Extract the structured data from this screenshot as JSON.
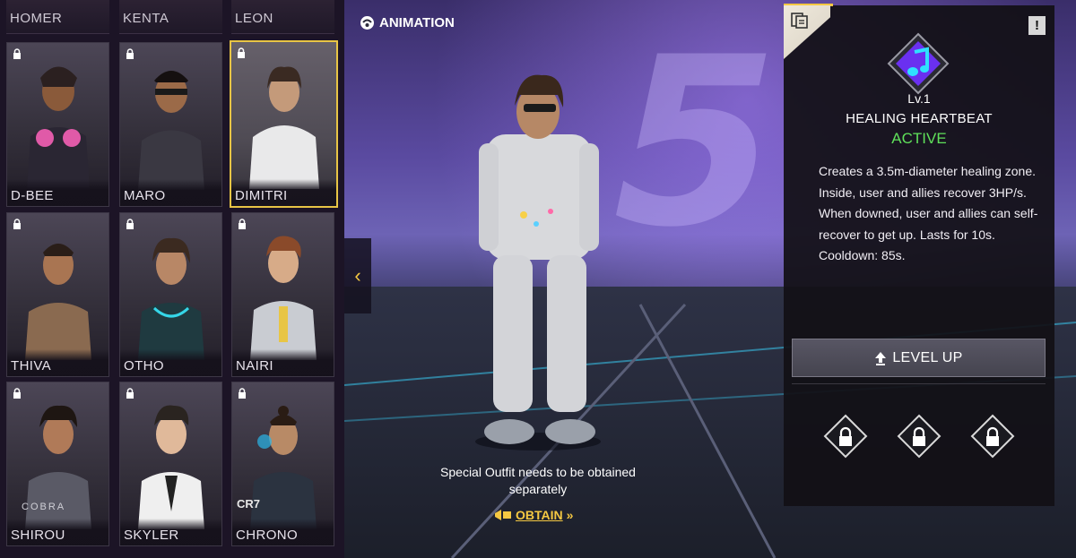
{
  "top_row": [
    "HOMER",
    "KENTA",
    "LEON"
  ],
  "characters": [
    {
      "name": "D-BEE",
      "locked": true,
      "selected": false
    },
    {
      "name": "MARO",
      "locked": true,
      "selected": false
    },
    {
      "name": "DIMITRI",
      "locked": true,
      "selected": true
    },
    {
      "name": "THIVA",
      "locked": true,
      "selected": false
    },
    {
      "name": "OTHO",
      "locked": true,
      "selected": false
    },
    {
      "name": "NAIRI",
      "locked": true,
      "selected": false
    },
    {
      "name": "SHIROU",
      "locked": true,
      "selected": false
    },
    {
      "name": "SKYLER",
      "locked": true,
      "selected": false
    },
    {
      "name": "CHRONO",
      "locked": true,
      "selected": false
    }
  ],
  "card_marks": {
    "shirou_brand": "COBRA",
    "chrono_brand": "CR7"
  },
  "stage": {
    "animation_label": "ANIMATION",
    "outfit_note": "Special Outfit needs to be obtained separately",
    "obtain_label": "OBTAIN",
    "obtain_arrows": "»",
    "back_arrow": "‹"
  },
  "skill": {
    "level": "Lv.1",
    "name": "HEALING HEARTBEAT",
    "status": "ACTIVE",
    "description": "Creates a 3.5m-diameter healing zone. Inside, user and allies recover 3HP/s. When downed, user and allies can self-recover to get up. Lasts for 10s. Cooldown: 85s.",
    "level_up_label": "LEVEL UP",
    "locked_slots": 3,
    "alert_glyph": "!"
  },
  "colors": {
    "accent_yellow": "#f5c842",
    "active_green": "#5fe05a",
    "skill_purple": "#7b3cff"
  },
  "icons": [
    "lock-icon",
    "animation-icon",
    "chevron-left-icon",
    "obtain-icon",
    "alert-icon",
    "skill-music-note-icon",
    "upload-arrow-icon",
    "info-tab-icon"
  ]
}
